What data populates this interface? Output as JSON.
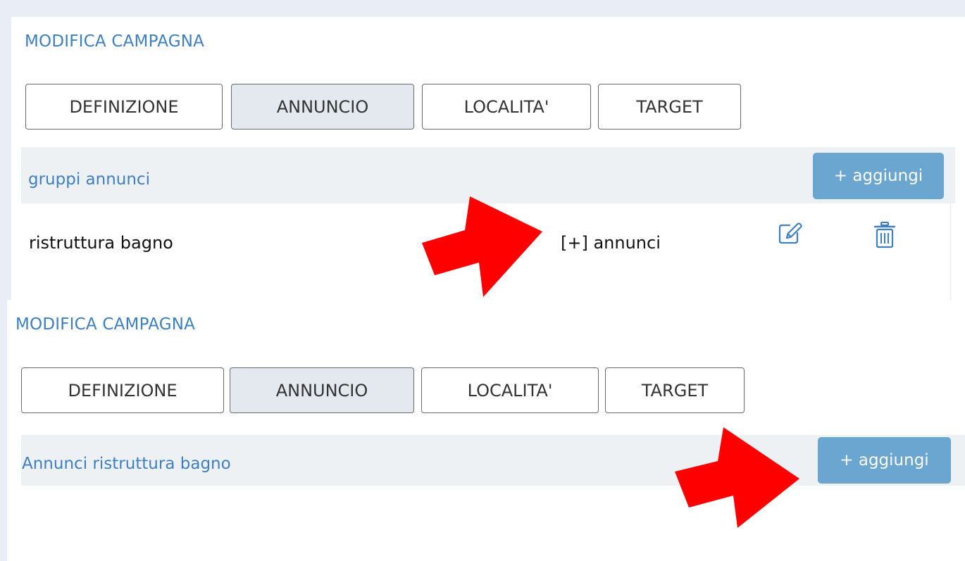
{
  "top": {
    "title": "MODIFICA CAMPAGNA",
    "tabs": [
      "DEFINIZIONE",
      "ANNUNCIO",
      "LOCALITA'",
      "TARGET"
    ],
    "active_tab": "ANNUNCIO",
    "section_label": "gruppi annunci",
    "add_button": "+ aggiungi",
    "row": {
      "name": "ristruttura bagno",
      "expand_link": "[+] annunci",
      "edit_icon": "pencil-square-icon",
      "delete_icon": "trash-icon"
    }
  },
  "bottom": {
    "title": "MODIFICA CAMPAGNA",
    "tabs": [
      "DEFINIZIONE",
      "ANNUNCIO",
      "LOCALITA'",
      "TARGET"
    ],
    "active_tab": "ANNUNCIO",
    "section_label": "Annunci ristruttura bagno",
    "add_button": "+ aggiungi"
  },
  "annotation": {
    "arrow_color": "#ff0000"
  },
  "colors": {
    "accent": "#3d7fc1",
    "button": "#6aa6cf",
    "active_tab": "#e3e9ee",
    "header_band": "#eef1f4",
    "page_background": "#e9edf5"
  }
}
